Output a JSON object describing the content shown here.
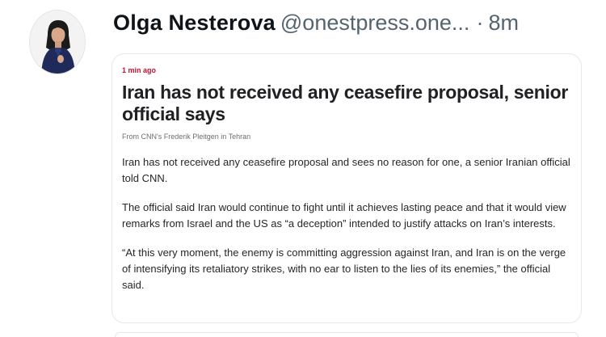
{
  "post": {
    "author_name": "Olga Nesterova",
    "author_handle": "@onestpress.one...",
    "separator": "·",
    "time": "8m",
    "avatar_icon": "profile-photo"
  },
  "article": {
    "timestamp": "1 min ago",
    "headline": "Iran has not received any ceasefire proposal, senior official says",
    "byline": "From CNN's Frederik Pleitgen in Tehran",
    "paragraphs": [
      "Iran has not received any ceasefire proposal and sees no reason for one, a senior Iranian official told CNN.",
      "The official said Iran would continue to fight until it achieves lasting peace and that it would view remarks from Israel and the US as “a deception” intended to justify attacks on Iran’s interests.",
      "“At this very moment, the enemy is committing aggression against Iran, and Iran is on the verge of intensifying its retaliatory strikes, with no ear to listen to the lies of its enemies,” the official said."
    ]
  },
  "colors": {
    "timestamp_red": "#c8102e",
    "handle_gray": "#536471",
    "card_border": "#e6e8eb",
    "jacket_navy": "#1f2a5a"
  }
}
